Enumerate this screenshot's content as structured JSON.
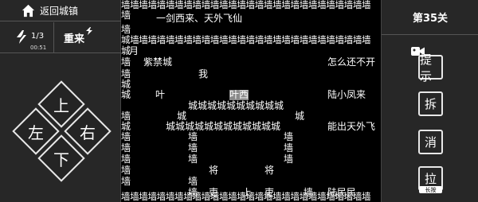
{
  "nav": {
    "back_label": "返回城镇"
  },
  "status": {
    "energy_count": "1/3",
    "energy_timer": "00:51",
    "restart_label": "重来"
  },
  "dpad": {
    "up": "上",
    "left": "左",
    "right": "右",
    "down": "下"
  },
  "level": {
    "label": "第35关"
  },
  "tools": {
    "hint": "提示",
    "dismantle": "拆",
    "eliminate": "消",
    "pull": "拉",
    "pull_note": "长按"
  },
  "board": {
    "top_wall": "墙墙墙墙墙墙墙墙墙墙墙墙墙墙墙墙墙墙墙墙墙墙墙墙墙墙墙墙",
    "second_wall": "城墙墙墙墙墙墙墙墙墙墙墙墙墙墙墙墙墙墙墙墙墙墙墙墙墙墙墙",
    "bottom_wall": "墙墙墙墙墙墙墙墙墙墙墙墙墙墙墙墙墙墙墙墙墙墙墙墙墙墙墙墙",
    "left_column": [
      "墙",
      "",
      "墙",
      "",
      "城",
      "墙",
      "墙",
      "城",
      "城",
      "墙",
      "城",
      "墙",
      "墙",
      "墙",
      "墙",
      "墙"
    ],
    "poem": "一剑西来、天外飞仙",
    "city_char": "月",
    "forbidden_city": "紫禁城",
    "player": "我",
    "question": "怎么还不开",
    "ye": "叶",
    "ye_xi": "叶西",
    "lu_xiaofeng": "陆小凤来",
    "city_row_1": "城城城城城城城城城城",
    "city_single_left": "城",
    "city_single_right": "城",
    "city_row_2": "城城城城城城城城城城城城",
    "can_tianwai": "能出天外飞",
    "inner_walls": [
      "墙",
      "墙",
      "墙",
      "墙",
      "墙",
      "墙",
      "墙",
      "墙"
    ],
    "general_left": "将",
    "general_right": "将",
    "officials": [
      "吏",
      "上",
      "吏"
    ],
    "inner_wall_bottom": "墙",
    "lu_people": "陆民民"
  }
}
